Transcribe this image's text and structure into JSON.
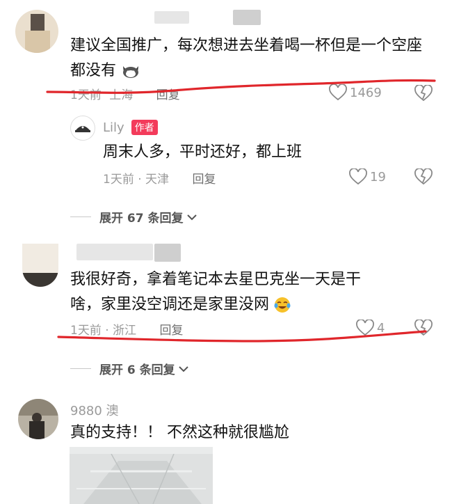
{
  "comments": [
    {
      "text": "建议全国推广，每次想进去坐着喝一杯但是一个空座都没有",
      "emoji": "cat-face-emoji",
      "meta_time": "1天前",
      "meta_location": "上海",
      "reply_label": "回复",
      "likes": "1469",
      "reply": {
        "author": "Lily",
        "badge": "作者",
        "text": "周末人多，平时还好，都上班",
        "meta": "1天前 · 天津",
        "reply_label": "回复",
        "likes": "19"
      },
      "expand_label": "展开 67 条回复"
    },
    {
      "text_line1": "我很好奇，拿着笔记本去星巴克坐一天是干",
      "text_line2": "啥，家里没空调还是家里没网",
      "emoji": "laughing-crying-emoji",
      "meta": "1天前 · 浙江",
      "reply_label": "回复",
      "likes": "4",
      "expand_label": "展开 6 条回复"
    },
    {
      "author": "9880 澳",
      "text": "真的支持！！ 不然这种就很尴尬"
    }
  ],
  "colors": {
    "annotation_red": "#e0262b",
    "author_badge": "#f33b5b"
  }
}
